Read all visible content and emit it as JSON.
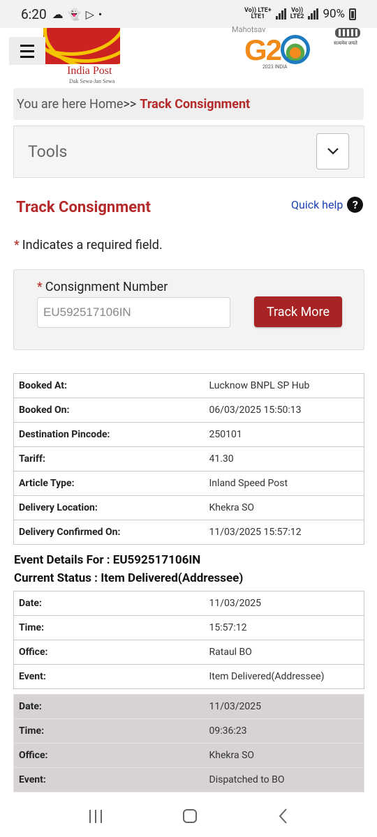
{
  "status_bar": {
    "time": "6:20",
    "sim1_top": "Vo)) LTE+",
    "sim1_bottom": "LTE1",
    "sim2_top": "Vo))",
    "sim2_bottom": "LTE2",
    "battery": "90%"
  },
  "header": {
    "logo_name": "India Post",
    "logo_tagline": "Dak Sewa-Jan Sewa",
    "g20_text": "G20",
    "g20_top": "Mahotsav",
    "g20_bottom": "2023 INDIA",
    "emblem_motto": "सत्यमेव जयते"
  },
  "breadcrumb": {
    "prefix": "You are here Home",
    "separator": ">>",
    "current": "Track Consignment"
  },
  "tools": {
    "label": "Tools"
  },
  "page": {
    "title": "Track Consignment",
    "quick_help": "Quick help",
    "required_note": "Indicates a required field."
  },
  "form": {
    "label": "Consignment Number",
    "value": "EU592517106IN",
    "button": "Track More"
  },
  "booking": [
    {
      "key": "Booked At:",
      "value": "Lucknow BNPL SP Hub"
    },
    {
      "key": "Booked On:",
      "value": "06/03/2025 15:50:13"
    },
    {
      "key": "Destination Pincode:",
      "value": "250101"
    },
    {
      "key": "Tariff:",
      "value": "41.30"
    },
    {
      "key": "Article Type:",
      "value": "Inland Speed Post"
    },
    {
      "key": "Delivery Location:",
      "value": "Khekra SO"
    },
    {
      "key": "Delivery Confirmed On:",
      "value": "11/03/2025 15:57:12"
    }
  ],
  "events_header": {
    "line1": "Event Details For : EU592517106IN",
    "line2": "Current Status : Item Delivered(Addressee)"
  },
  "events": [
    [
      {
        "key": "Date:",
        "value": "11/03/2025"
      },
      {
        "key": "Time:",
        "value": "15:57:12"
      },
      {
        "key": "Office:",
        "value": "Rataul BO"
      },
      {
        "key": "Event:",
        "value": "Item Delivered(Addressee)"
      }
    ],
    [
      {
        "key": "Date:",
        "value": "11/03/2025"
      },
      {
        "key": "Time:",
        "value": "09:36:23"
      },
      {
        "key": "Office:",
        "value": "Khekra SO"
      },
      {
        "key": "Event:",
        "value": "Dispatched to BO"
      }
    ]
  ]
}
